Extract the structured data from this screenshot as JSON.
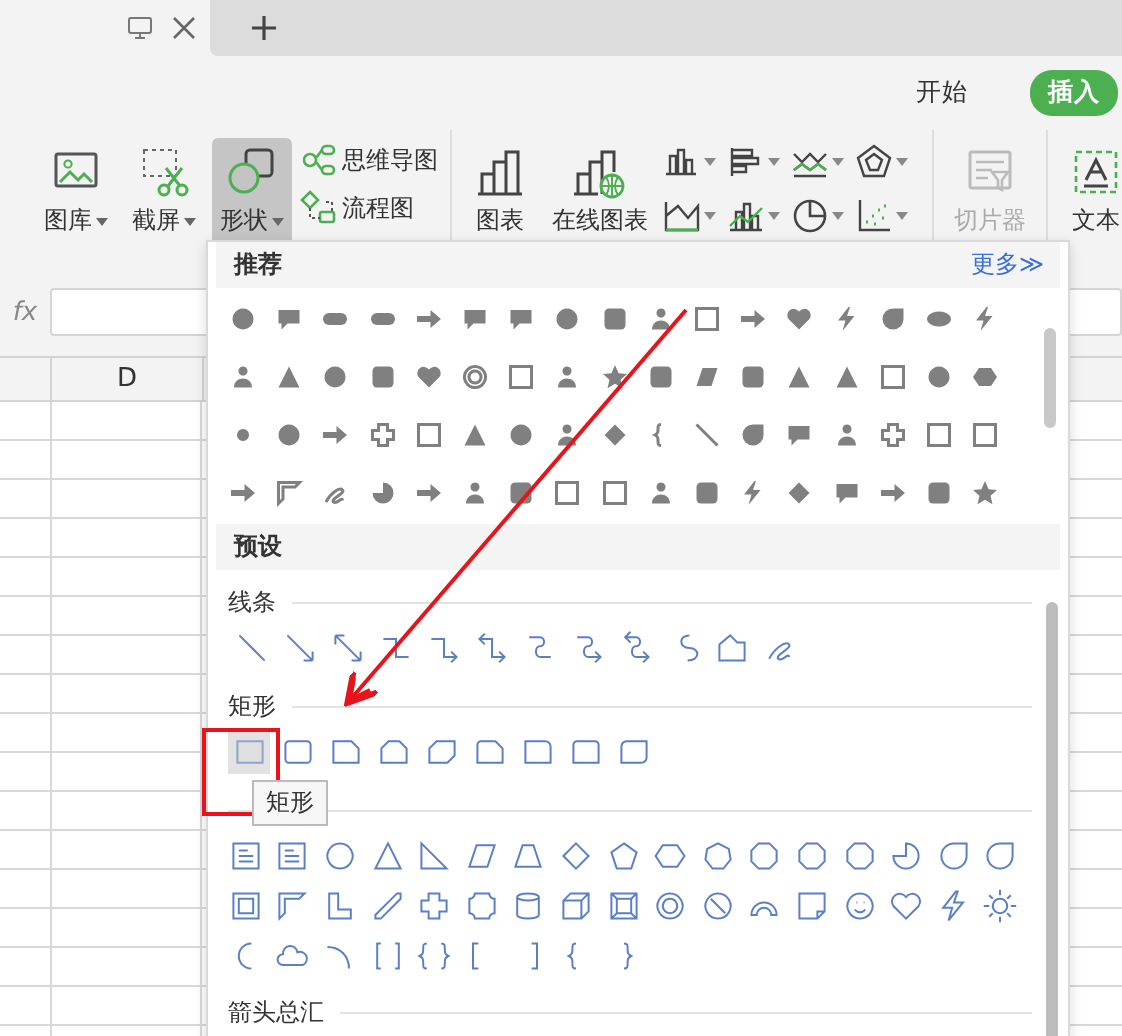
{
  "ribbon_tabs": [
    {
      "label": "开始",
      "selected": false
    },
    {
      "label": "插入",
      "selected": true
    }
  ],
  "ribbon_groups": [
    {
      "items": [
        {
          "kind": "big",
          "label": "图库",
          "dropdown": true,
          "selected": false,
          "disabled": false
        },
        {
          "kind": "big",
          "label": "截屏",
          "dropdown": true,
          "selected": false,
          "disabled": false
        },
        {
          "kind": "big",
          "label": "形状",
          "dropdown": true,
          "selected": true,
          "disabled": false
        },
        {
          "kind": "stack",
          "rows": [
            {
              "label": "思维导图"
            },
            {
              "label": "流程图"
            }
          ]
        }
      ]
    },
    {
      "items": [
        {
          "kind": "big",
          "label": "图表",
          "dropdown": false,
          "selected": false,
          "disabled": false
        },
        {
          "kind": "big",
          "label": "在线图表",
          "dropdown": false,
          "selected": false,
          "disabled": false
        },
        {
          "kind": "chart-types"
        }
      ]
    },
    {
      "items": [
        {
          "kind": "big",
          "label": "切片器",
          "dropdown": false,
          "selected": false,
          "disabled": true
        }
      ]
    },
    {
      "items": [
        {
          "kind": "big",
          "label": "文本",
          "dropdown": false,
          "selected": false,
          "disabled": false
        }
      ]
    }
  ],
  "formula_bar": {
    "label": "fx"
  },
  "sheet": {
    "column_header": "D"
  },
  "shape_menu": {
    "recommended": {
      "title": "推荐",
      "more_link": "更多≫"
    },
    "presets": {
      "title": "预设",
      "groups": [
        {
          "kind": "lines",
          "label": "线条"
        },
        {
          "kind": "rectangles",
          "label": "矩形",
          "tooltip": "矩形",
          "shapes": [
            {
              "selected": true
            },
            {
              "selected": false
            },
            {
              "selected": false
            },
            {
              "selected": false
            },
            {
              "selected": false
            },
            {
              "selected": false
            },
            {
              "selected": false
            },
            {
              "selected": false
            },
            {
              "selected": false
            }
          ]
        },
        {
          "kind": "basic"
        },
        {
          "kind": "arrows",
          "label": "箭头总汇"
        }
      ]
    }
  }
}
